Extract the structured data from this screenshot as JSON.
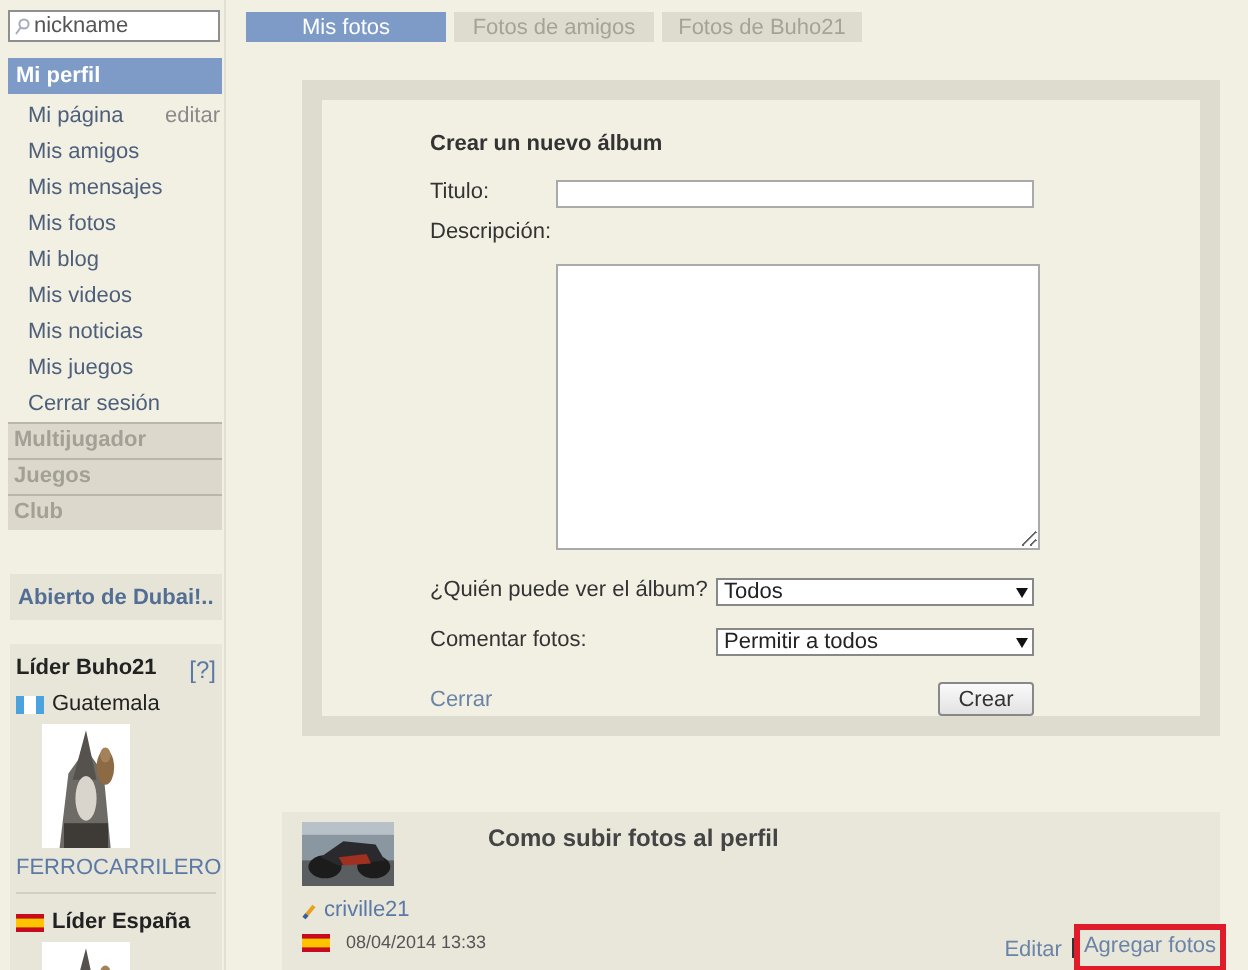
{
  "search": {
    "placeholder": "nickname"
  },
  "sidebar": {
    "header": "Mi perfil",
    "items": [
      {
        "label": "Mi página",
        "action": "editar"
      },
      {
        "label": "Mis amigos"
      },
      {
        "label": "Mis mensajes"
      },
      {
        "label": "Mis fotos"
      },
      {
        "label": "Mi blog"
      },
      {
        "label": "Mis videos"
      },
      {
        "label": "Mis noticias"
      },
      {
        "label": "Mis juegos"
      },
      {
        "label": "Cerrar sesión"
      }
    ],
    "sections": [
      "Multijugador",
      "Juegos",
      "Club"
    ]
  },
  "promo": "Abierto de Dubai!..",
  "leaders": [
    {
      "title": "Líder Buho21",
      "help": "[?]",
      "flag": {
        "kind": "guatemala"
      },
      "country": "Guatemala",
      "name": "FERROCARRILERO"
    },
    {
      "title": "Líder España",
      "flag": {
        "kind": "spain"
      }
    }
  ],
  "tabs": [
    {
      "label": "Mis fotos",
      "selected": true
    },
    {
      "label": "Fotos de amigos",
      "selected": false
    },
    {
      "label": "Fotos de Buho21",
      "selected": false
    }
  ],
  "form": {
    "title": "Crear un nuevo álbum",
    "fields": [
      {
        "kind": "text",
        "label": "Titulo:"
      },
      {
        "kind": "textarea",
        "label": "Descripción:"
      },
      {
        "kind": "select",
        "label": "¿Quién puede ver el álbum?",
        "value": "Todos"
      },
      {
        "kind": "select",
        "label": "Comentar fotos:",
        "value": "Permitir a todos"
      }
    ],
    "close": "Cerrar",
    "submit": "Crear"
  },
  "post": {
    "title": "Como subir fotos al perfil",
    "author": "criville21",
    "flag": {
      "kind": "spain"
    },
    "date": "08/04/2014 13:33",
    "actions": [
      {
        "label": "Editar",
        "highlighted": false
      },
      {
        "label": "Agregar fotos",
        "highlighted": true
      }
    ]
  }
}
